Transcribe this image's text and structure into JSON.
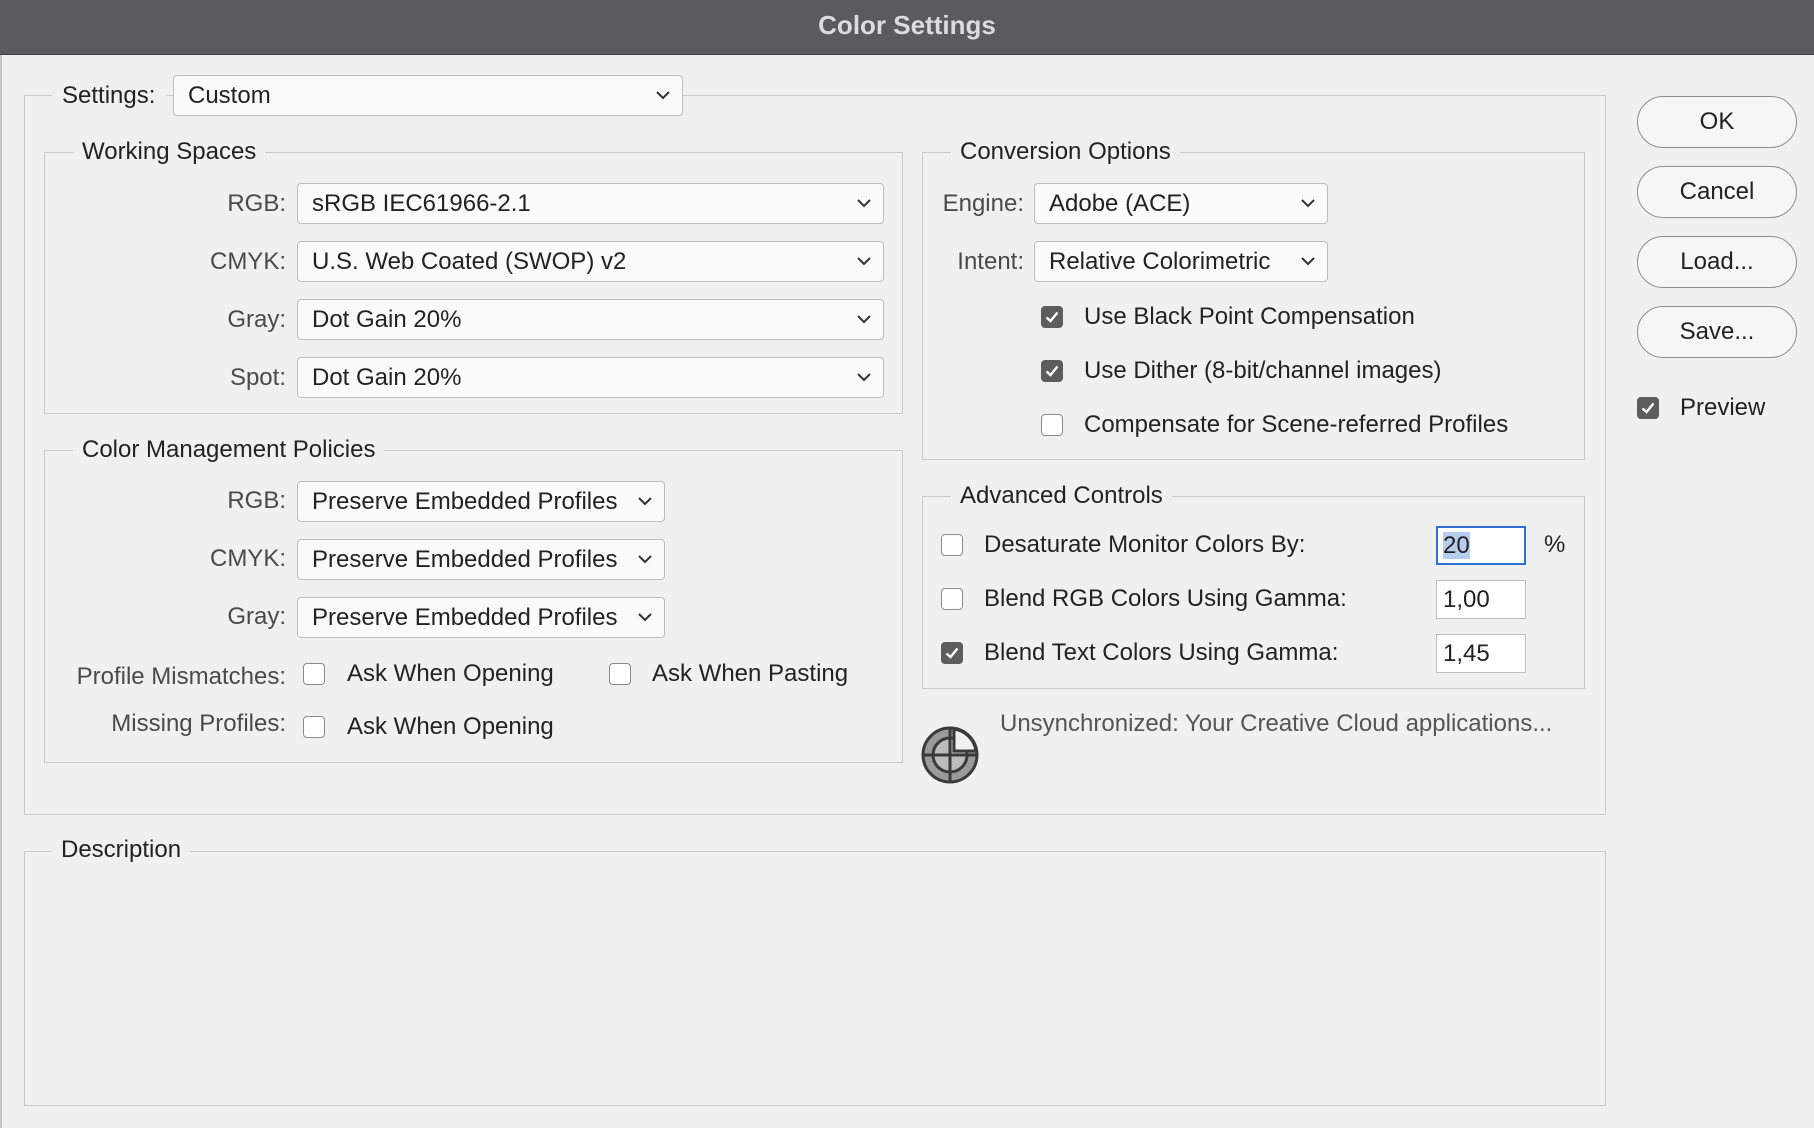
{
  "window": {
    "title": "Color Settings"
  },
  "settings": {
    "label": "Settings:",
    "value": "Custom"
  },
  "working_spaces": {
    "title": "Working Spaces",
    "rgb": {
      "label": "RGB:",
      "value": "sRGB IEC61966-2.1"
    },
    "cmyk": {
      "label": "CMYK:",
      "value": "U.S. Web Coated (SWOP) v2"
    },
    "gray": {
      "label": "Gray:",
      "value": "Dot Gain 20%"
    },
    "spot": {
      "label": "Spot:",
      "value": "Dot Gain 20%"
    }
  },
  "policies": {
    "title": "Color Management Policies",
    "rgb": {
      "label": "RGB:",
      "value": "Preserve Embedded Profiles"
    },
    "cmyk": {
      "label": "CMYK:",
      "value": "Preserve Embedded Profiles"
    },
    "gray": {
      "label": "Gray:",
      "value": "Preserve Embedded Profiles"
    },
    "profile_mismatches": {
      "label": "Profile Mismatches:",
      "ask_opening": {
        "label": "Ask When Opening",
        "checked": false
      },
      "ask_pasting": {
        "label": "Ask When Pasting",
        "checked": false
      }
    },
    "missing_profiles": {
      "label": "Missing Profiles:",
      "ask_opening": {
        "label": "Ask When Opening",
        "checked": false
      }
    }
  },
  "conversion": {
    "title": "Conversion Options",
    "engine": {
      "label": "Engine:",
      "value": "Adobe (ACE)"
    },
    "intent": {
      "label": "Intent:",
      "value": "Relative Colorimetric"
    },
    "black_point": {
      "label": "Use Black Point Compensation",
      "checked": true
    },
    "dither": {
      "label": "Use Dither (8-bit/channel images)",
      "checked": true
    },
    "scene_referred": {
      "label": "Compensate for Scene-referred Profiles",
      "checked": false
    }
  },
  "advanced": {
    "title": "Advanced Controls",
    "desaturate": {
      "label": "Desaturate Monitor Colors By:",
      "checked": false,
      "value": "20",
      "unit": "%"
    },
    "blend_rgb": {
      "label": "Blend RGB Colors Using Gamma:",
      "checked": false,
      "value": "1,00"
    },
    "blend_text": {
      "label": "Blend Text Colors Using Gamma:",
      "checked": true,
      "value": "1,45"
    }
  },
  "sync": {
    "icon": "sync-status-icon",
    "message": "Unsynchronized: Your Creative Cloud applications..."
  },
  "description": {
    "title": "Description"
  },
  "buttons": {
    "ok": "OK",
    "cancel": "Cancel",
    "load": "Load...",
    "save": "Save..."
  },
  "preview": {
    "label": "Preview",
    "checked": true
  },
  "colors": {
    "focus": "#2f6fd1",
    "checkbox_checked": "#5d5d5d",
    "titlebar": "#5b5b5d"
  }
}
